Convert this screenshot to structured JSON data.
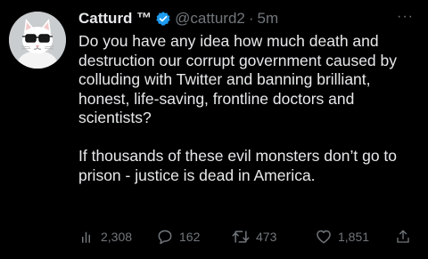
{
  "tweet": {
    "author": {
      "name": "Catturd ™",
      "handle": "@catturd2",
      "separator": "·",
      "time": "5m",
      "verified": true
    },
    "more_label": "···",
    "text": {
      "paragraph1": "Do you have any idea how much death and destruction our corrupt government caused by colluding with Twitter and banning brilliant, honest, life-saving, frontline doctors and scientists?",
      "paragraph2": "If thousands of these evil monsters don’t go to prison - justice is dead in America."
    },
    "metrics": {
      "views": "2,308",
      "replies": "162",
      "retweets": "473",
      "likes": "1,851"
    },
    "icons": {
      "views": "bar-chart-icon",
      "reply": "speech-bubble-icon",
      "retweet": "retweet-arrows-icon",
      "like": "heart-icon",
      "share": "share-upload-icon",
      "verified": "verified-badge-icon"
    },
    "colors": {
      "background": "#000000",
      "text": "#e7e9ea",
      "muted": "#71767b",
      "verified": "#1d9bf0"
    }
  }
}
